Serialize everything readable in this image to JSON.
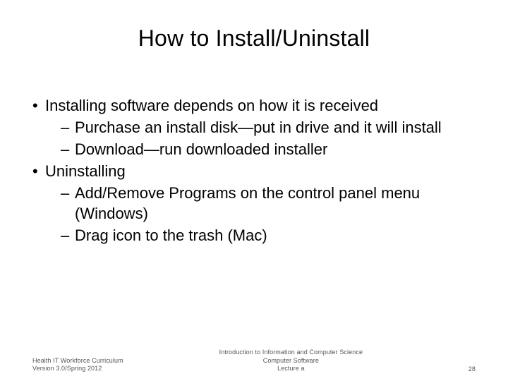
{
  "title": "How to Install/Uninstall",
  "bullets": [
    {
      "text": "Installing software depends on how it is received",
      "sub": [
        "Purchase an install disk—put in drive and it will install",
        "Download—run downloaded installer"
      ]
    },
    {
      "text": "Uninstalling",
      "sub": [
        "Add/Remove Programs on the control panel menu (Windows)",
        "Drag icon to the trash (Mac)"
      ]
    }
  ],
  "footer": {
    "left_line1": "Health IT Workforce Curriculum",
    "left_line2": "Version 3.0/Spring 2012",
    "center_line1": "Introduction to Information and Computer Science",
    "center_line2": "Computer Software",
    "center_line3": "Lecture a",
    "page": "28"
  }
}
